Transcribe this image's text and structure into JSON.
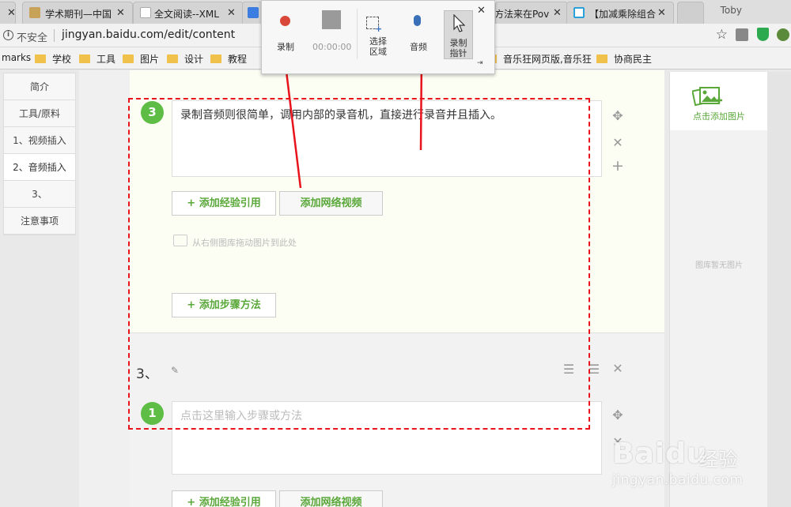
{
  "tabs": [
    {
      "title": "",
      "close": "✕"
    },
    {
      "title": "学术期刊—中国",
      "close": "✕"
    },
    {
      "title": "全文阅读--XML",
      "close": "✕"
    },
    {
      "title": "",
      "close": "✕"
    },
    {
      "title": "方法来在Pov",
      "close": "✕"
    },
    {
      "title": "【加减乘除组合",
      "close": "✕"
    }
  ],
  "browser": {
    "user": "Toby",
    "insecure_label": "不安全",
    "url": "jingyan.baidu.com/edit/content",
    "star": "☆"
  },
  "bookmarks": [
    {
      "label": "marks",
      "folder": false
    },
    {
      "label": "学校",
      "folder": true
    },
    {
      "label": "工具",
      "folder": true
    },
    {
      "label": "图片",
      "folder": true
    },
    {
      "label": "设计",
      "folder": true
    },
    {
      "label": "教程",
      "folder": true
    },
    {
      "label": "音乐狂网页版,音乐狂",
      "folder": true
    },
    {
      "label": "协商民主",
      "folder": true
    }
  ],
  "sidebar": {
    "items": [
      {
        "label": "简介"
      },
      {
        "label": "工具/原料"
      },
      {
        "label": "1、视频插入"
      },
      {
        "label": "2、音频插入"
      },
      {
        "label": "3、"
      },
      {
        "label": "注意事项"
      }
    ]
  },
  "step": {
    "number": "3",
    "text": "录制音频则很简单，调用内部的录音机，直接进行录音并且插入。",
    "add_reference": "+ 添加经验引用",
    "add_video": "添加网络视频",
    "drag_hint": "从右侧图库拖动图片到此处",
    "add_step": "+ 添加步骤方法"
  },
  "section3": {
    "title": "3、",
    "step_number": "1",
    "placeholder": "点击这里输入步骤或方法",
    "add_reference": "+ 添加经验引用",
    "add_video": "添加网络视频"
  },
  "right_panel": {
    "add_image": "点击添加图片",
    "no_images": "图库暂无图片"
  },
  "recorder": {
    "record": "录制",
    "timer": "00:00:00",
    "select_region": "选择\n区域",
    "audio": "音频",
    "record_pointer": "录制\n指针",
    "close": "✕",
    "pin": "⇥"
  },
  "watermark": {
    "brand": "Baidu",
    "product": "经验",
    "url": "jingyan.baidu.com"
  },
  "colors": {
    "accent_green": "#5aa83a",
    "annotation_red": "#e8131b",
    "record_red": "#d9473a"
  }
}
